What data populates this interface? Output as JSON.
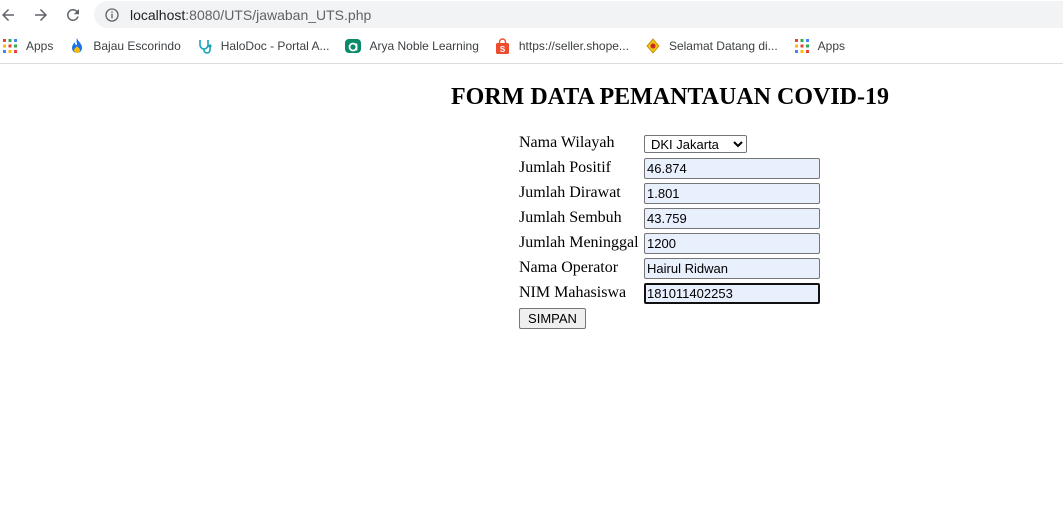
{
  "browser": {
    "url_host": "localhost",
    "url_path": ":8080/UTS/jawaban_UTS.php",
    "bookmarks": [
      {
        "label": "Apps",
        "icon": "apps-grid-icon"
      },
      {
        "label": "Bajau Escorindo",
        "icon": "flame-icon"
      },
      {
        "label": "HaloDoc - Portal A...",
        "icon": "stethoscope-icon"
      },
      {
        "label": "Arya Noble Learning",
        "icon": "arya-logo-icon"
      },
      {
        "label": "https://seller.shope...",
        "icon": "shopee-bag-icon"
      },
      {
        "label": "Selamat Datang di...",
        "icon": "emblem-icon"
      },
      {
        "label": "Apps",
        "icon": "apps-grid-icon"
      }
    ]
  },
  "page": {
    "title": "FORM DATA PEMANTAUAN COVID-19"
  },
  "form": {
    "fields": [
      {
        "label": "Nama Wilayah",
        "type": "select",
        "value": "DKI Jakarta"
      },
      {
        "label": "Jumlah Positif",
        "type": "text",
        "value": "46.874"
      },
      {
        "label": "Jumlah Dirawat",
        "type": "text",
        "value": "1.801"
      },
      {
        "label": "Jumlah Sembuh",
        "type": "text",
        "value": "43.759"
      },
      {
        "label": "Jumlah Meninggal",
        "type": "text",
        "value": "1200"
      },
      {
        "label": "Nama Operator",
        "type": "text",
        "value": "Hairul Ridwan"
      },
      {
        "label": "NIM Mahasiswa",
        "type": "text",
        "value": "181011402253"
      }
    ],
    "submit_label": "SIMPAN"
  }
}
